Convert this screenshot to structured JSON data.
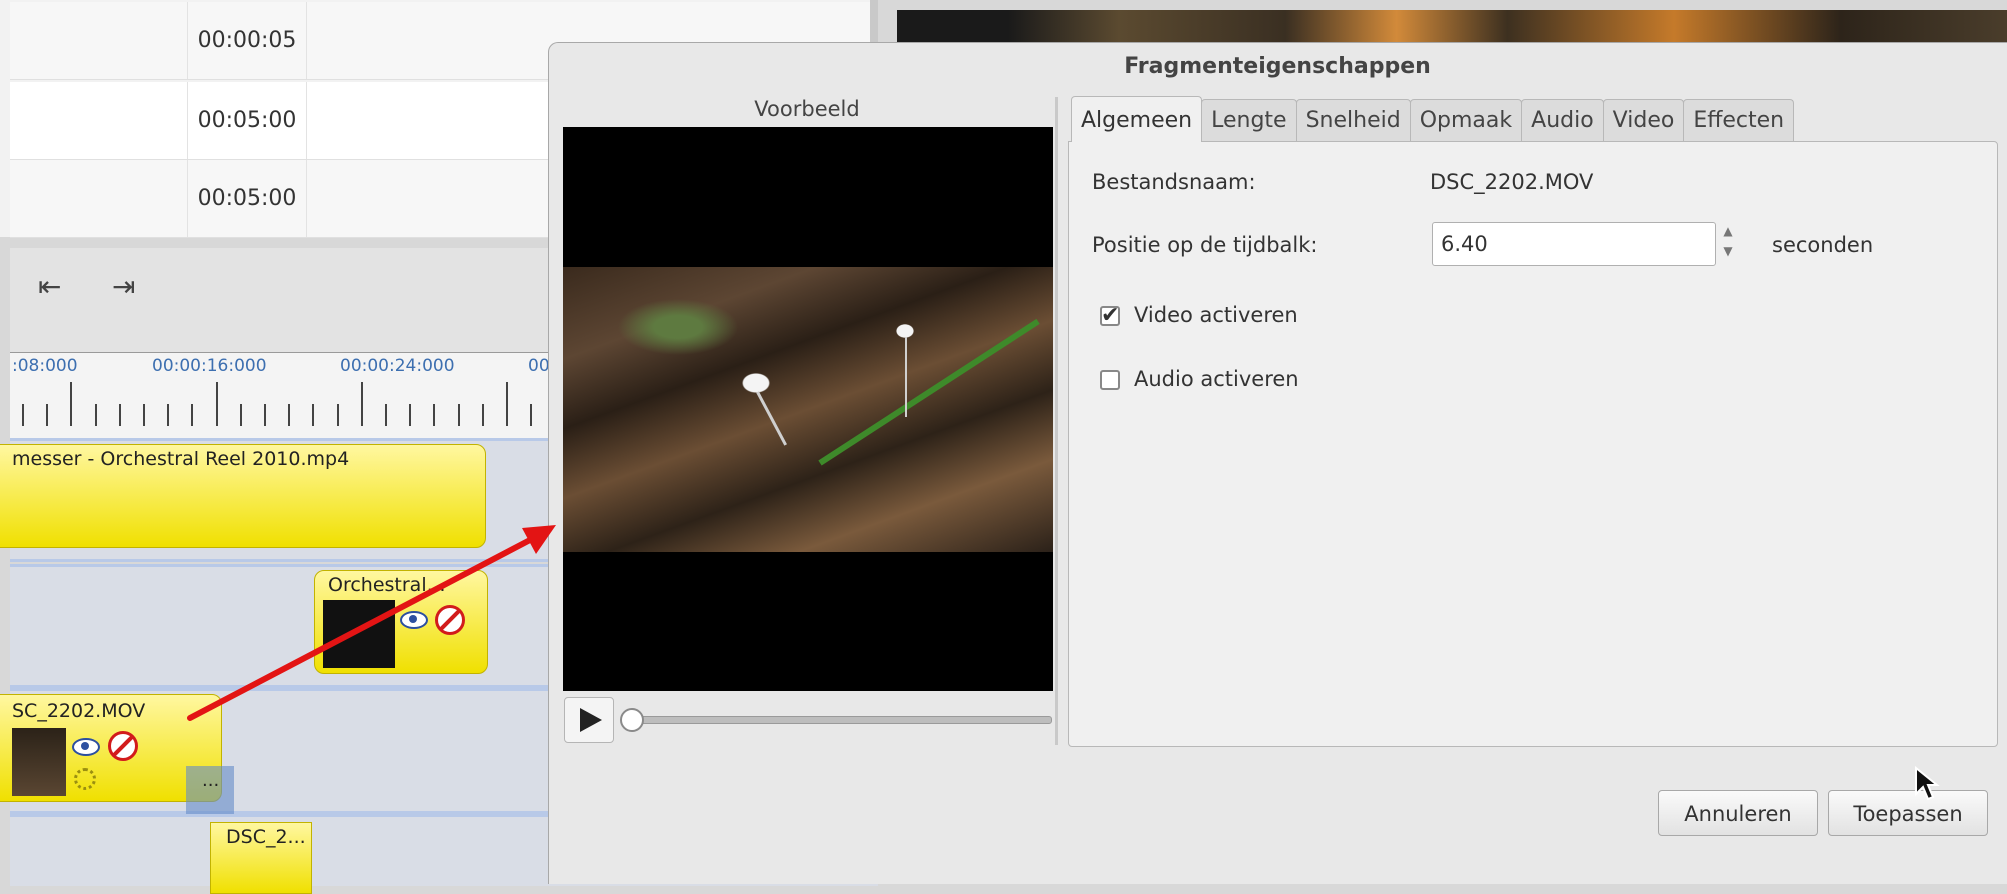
{
  "background": {
    "list_rows": [
      {
        "time": "00:00:05"
      },
      {
        "time": "00:05:00"
      },
      {
        "time": "00:05:00"
      }
    ],
    "toolbar": {
      "skip_start_icon": "⇤",
      "skip_end_icon": "⇥"
    },
    "ruler_labels": [
      ":08:000",
      "00:00:16:000",
      "00:00:24:000",
      "00"
    ],
    "tracks": {
      "audio_clip_label": "messer - Orchestral Reel 2010.mp4",
      "title_clip_label": "Orchestral…",
      "video_clip_label": "SC_2202.MOV",
      "gap_label": "...",
      "lower_clip_label": "DSC_2..."
    }
  },
  "dialog": {
    "title": "Fragmenteigenschappen",
    "preview_label": "Voorbeeld",
    "tabs": [
      {
        "label": "Algemeen",
        "active": true
      },
      {
        "label": "Lengte"
      },
      {
        "label": "Snelheid"
      },
      {
        "label": "Opmaak"
      },
      {
        "label": "Audio"
      },
      {
        "label": "Video"
      },
      {
        "label": "Effecten"
      }
    ],
    "fields": {
      "filename_label": "Bestandsnaam:",
      "filename_value": "DSC_2202.MOV",
      "position_label": "Positie op de tijdbalk:",
      "position_value": "6.40",
      "position_unit": "seconden",
      "video_enable_label": "Video activeren",
      "video_enable_checked": true,
      "audio_enable_label": "Audio activeren",
      "audio_enable_checked": false
    },
    "buttons": {
      "cancel": "Annuleren",
      "apply": "Toepassen"
    }
  },
  "colors": {
    "clip_yellow": "#f0e000",
    "annotation_arrow": "#e31414",
    "ruler_text": "#3d6fb0"
  }
}
